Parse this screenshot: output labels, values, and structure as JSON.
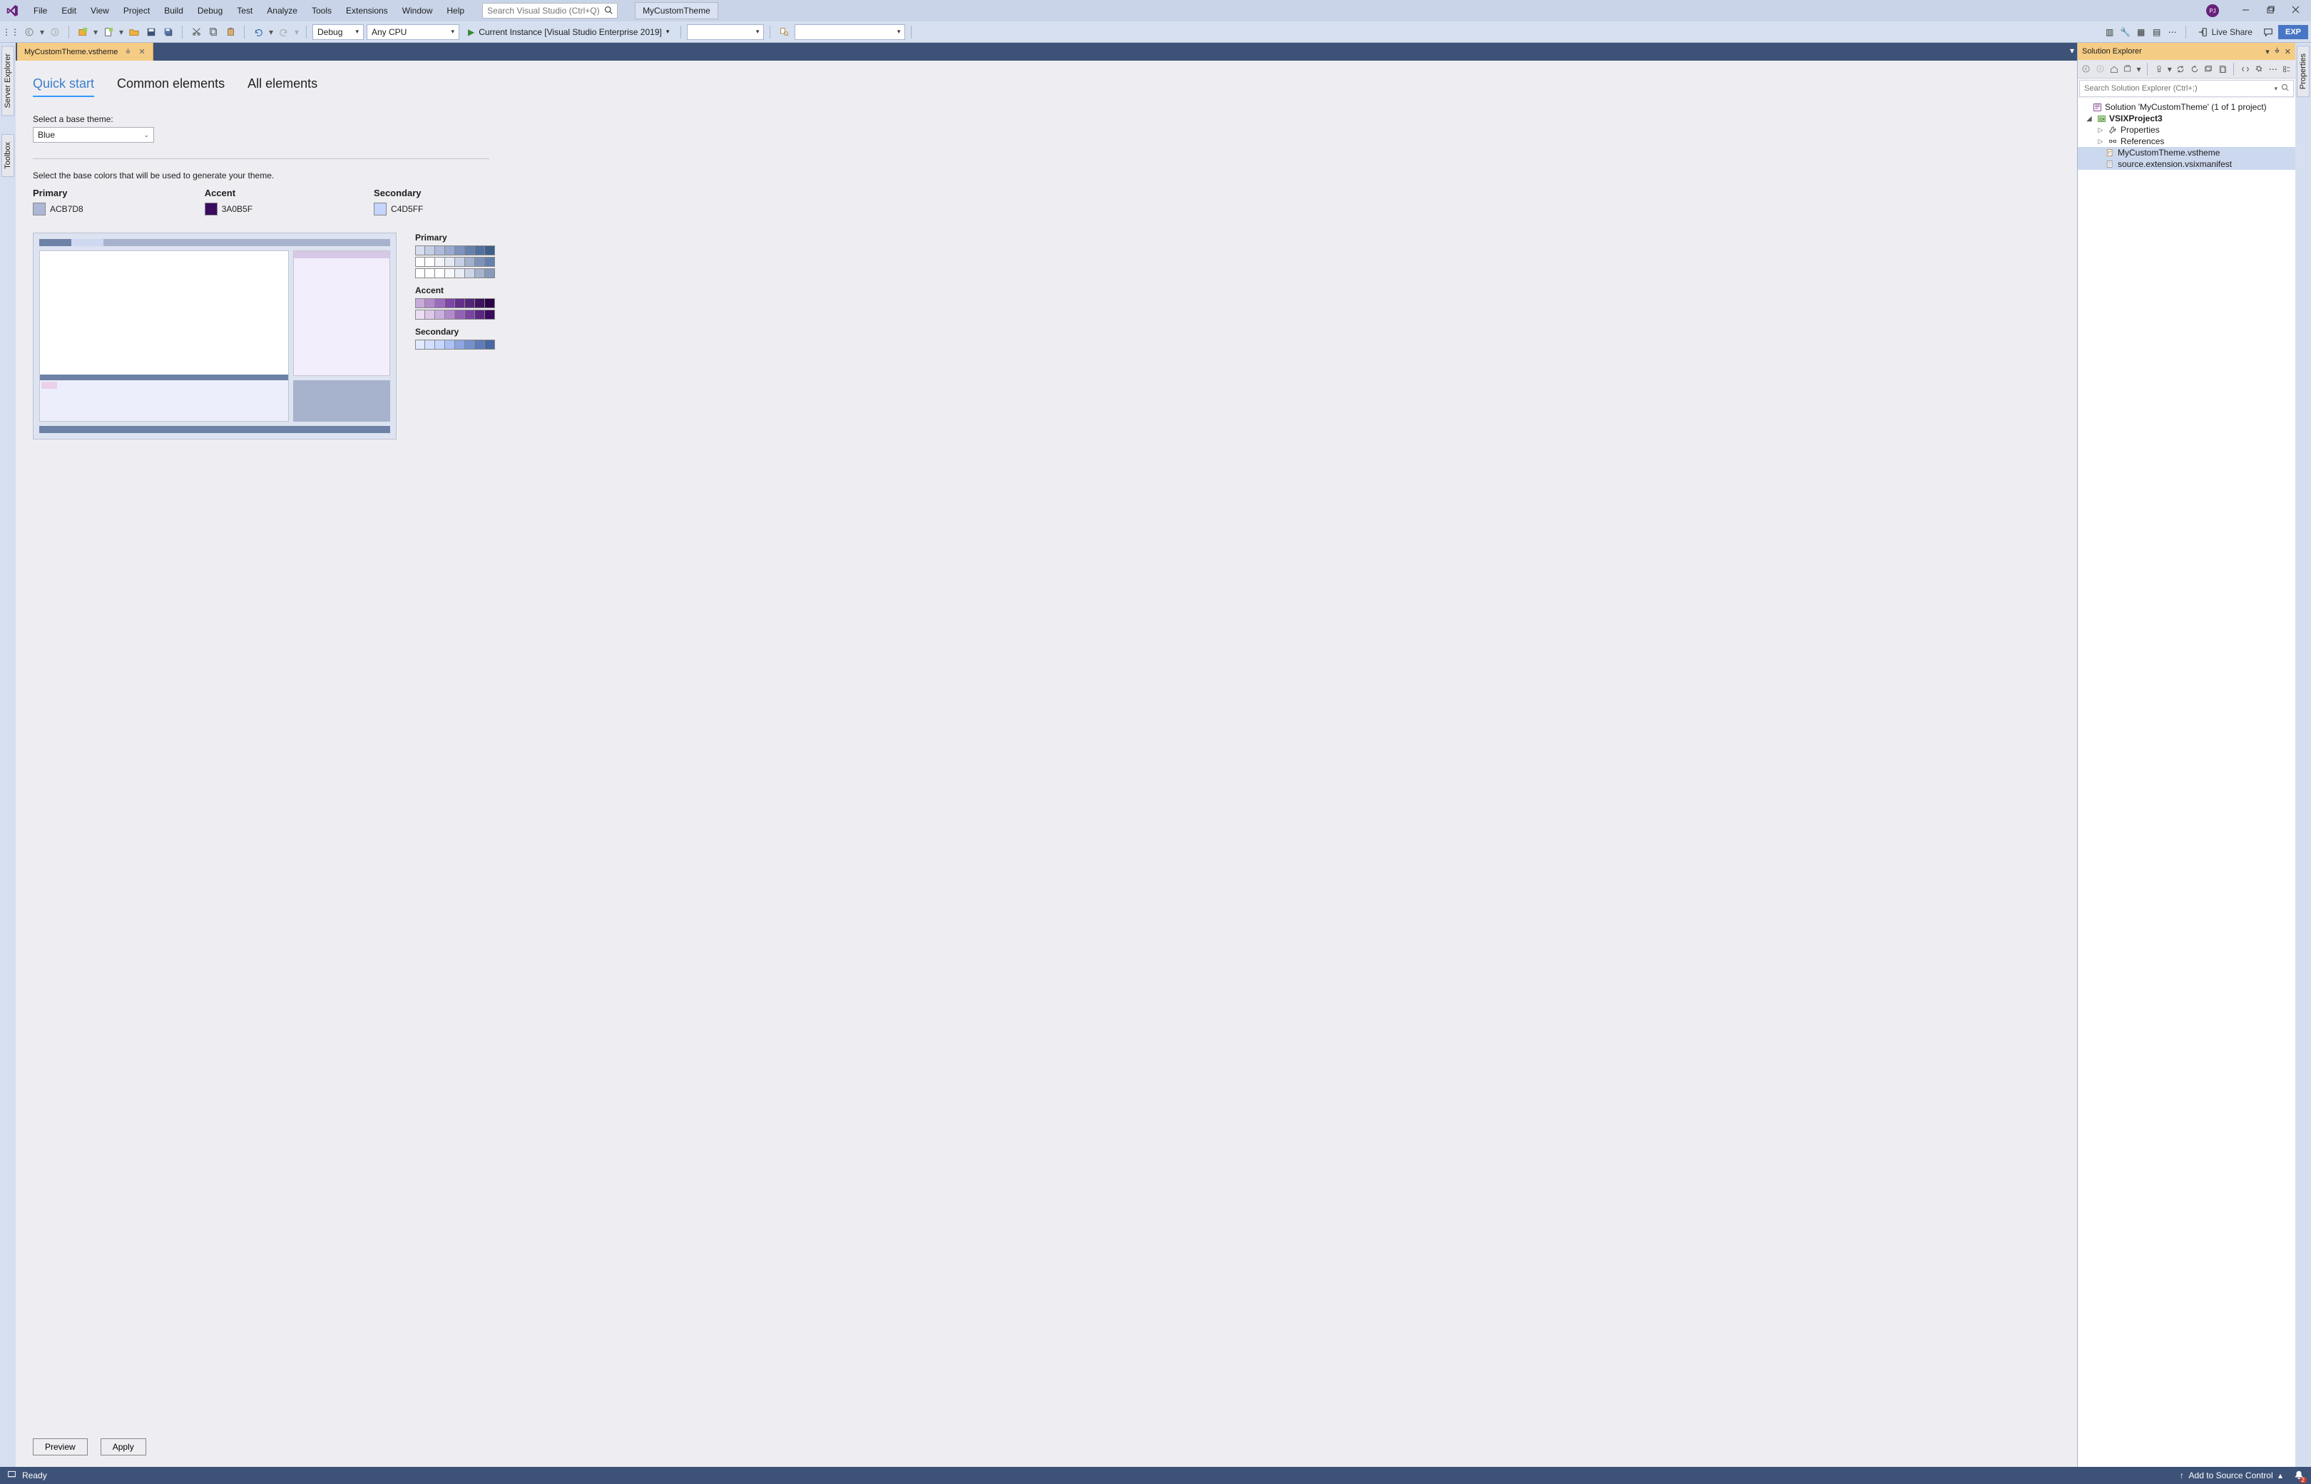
{
  "titlebar": {
    "menus": [
      "File",
      "Edit",
      "View",
      "Project",
      "Build",
      "Debug",
      "Test",
      "Analyze",
      "Tools",
      "Extensions",
      "Window",
      "Help"
    ],
    "search_placeholder": "Search Visual Studio (Ctrl+Q)",
    "current_doc": "MyCustomTheme",
    "user_initials": "PJ"
  },
  "toolbar": {
    "config": "Debug",
    "platform": "Any CPU",
    "run_label": "Current Instance [Visual Studio Enterprise 2019]",
    "live_share": "Live Share",
    "exp": "EXP"
  },
  "left_tabs": [
    "Server Explorer",
    "Toolbox"
  ],
  "right_tabs": [
    "Properties"
  ],
  "doc_tabs": [
    {
      "label": "MyCustomTheme.vstheme"
    }
  ],
  "doc_tab_overflow": "▾",
  "designer": {
    "tabs": [
      "Quick start",
      "Common elements",
      "All elements"
    ],
    "active_tab": 0,
    "base_theme_label": "Select a base theme:",
    "base_theme_value": "Blue",
    "base_colors_label": "Select the base colors that will be used to generate your theme.",
    "primary": {
      "label": "Primary",
      "hex": "ACB7D8",
      "color": "#ACB7D8"
    },
    "accent": {
      "label": "Accent",
      "hex": "3A0B5F",
      "color": "#3A0B5F"
    },
    "secondary": {
      "label": "Secondary",
      "hex": "C4D5FF",
      "color": "#C4D5FF"
    },
    "palette_labels": {
      "primary": "Primary",
      "accent": "Accent",
      "secondary": "Secondary"
    },
    "palettes": {
      "primary": [
        [
          "#D7DEEF",
          "#C4CEE6",
          "#AFBBDB",
          "#9AABD0",
          "#7E93BE",
          "#6580AE",
          "#50709F",
          "#3F5F8D"
        ],
        [
          "#FFFFFF",
          "#FFFFFF",
          "#F2F4FA",
          "#E3E8F3",
          "#C7D0E5",
          "#A3B1CE",
          "#7F93BA",
          "#6580AE"
        ],
        [
          "#FFFFFF",
          "#FFFFFF",
          "#FFFFFF",
          "#F7F8FC",
          "#E8ECF5",
          "#CDD5E7",
          "#A7B4CF",
          "#8899BC"
        ]
      ],
      "accent": [
        [
          "#C8AADA",
          "#B18BCC",
          "#9B6CBE",
          "#7E46A7",
          "#652F8C",
          "#542578",
          "#3E1260",
          "#2B0047"
        ],
        [
          "#EBDEF3",
          "#DCC7E9",
          "#CAAEDE",
          "#B18BCC",
          "#9263B5",
          "#7A45A1",
          "#5C2783",
          "#3A0B5F"
        ]
      ],
      "secondary": [
        [
          "#E1E9FF",
          "#D3DFFF",
          "#C4D5FF",
          "#ACC1F5",
          "#8DA6E0",
          "#7490CC",
          "#5D7BB8",
          "#4867A3"
        ]
      ]
    },
    "preview_btn": "Preview",
    "apply_btn": "Apply"
  },
  "solex": {
    "title": "Solution Explorer",
    "search_placeholder": "Search Solution Explorer (Ctrl+;)",
    "solution": "Solution 'MyCustomTheme' (1 of 1 project)",
    "project": "VSIXProject3",
    "nodes": {
      "properties": "Properties",
      "references": "References",
      "theme": "MyCustomTheme.vstheme",
      "manifest": "source.extension.vsixmanifest"
    }
  },
  "statusbar": {
    "ready": "Ready",
    "src_control": "Add to Source Control",
    "notif_count": "2"
  }
}
